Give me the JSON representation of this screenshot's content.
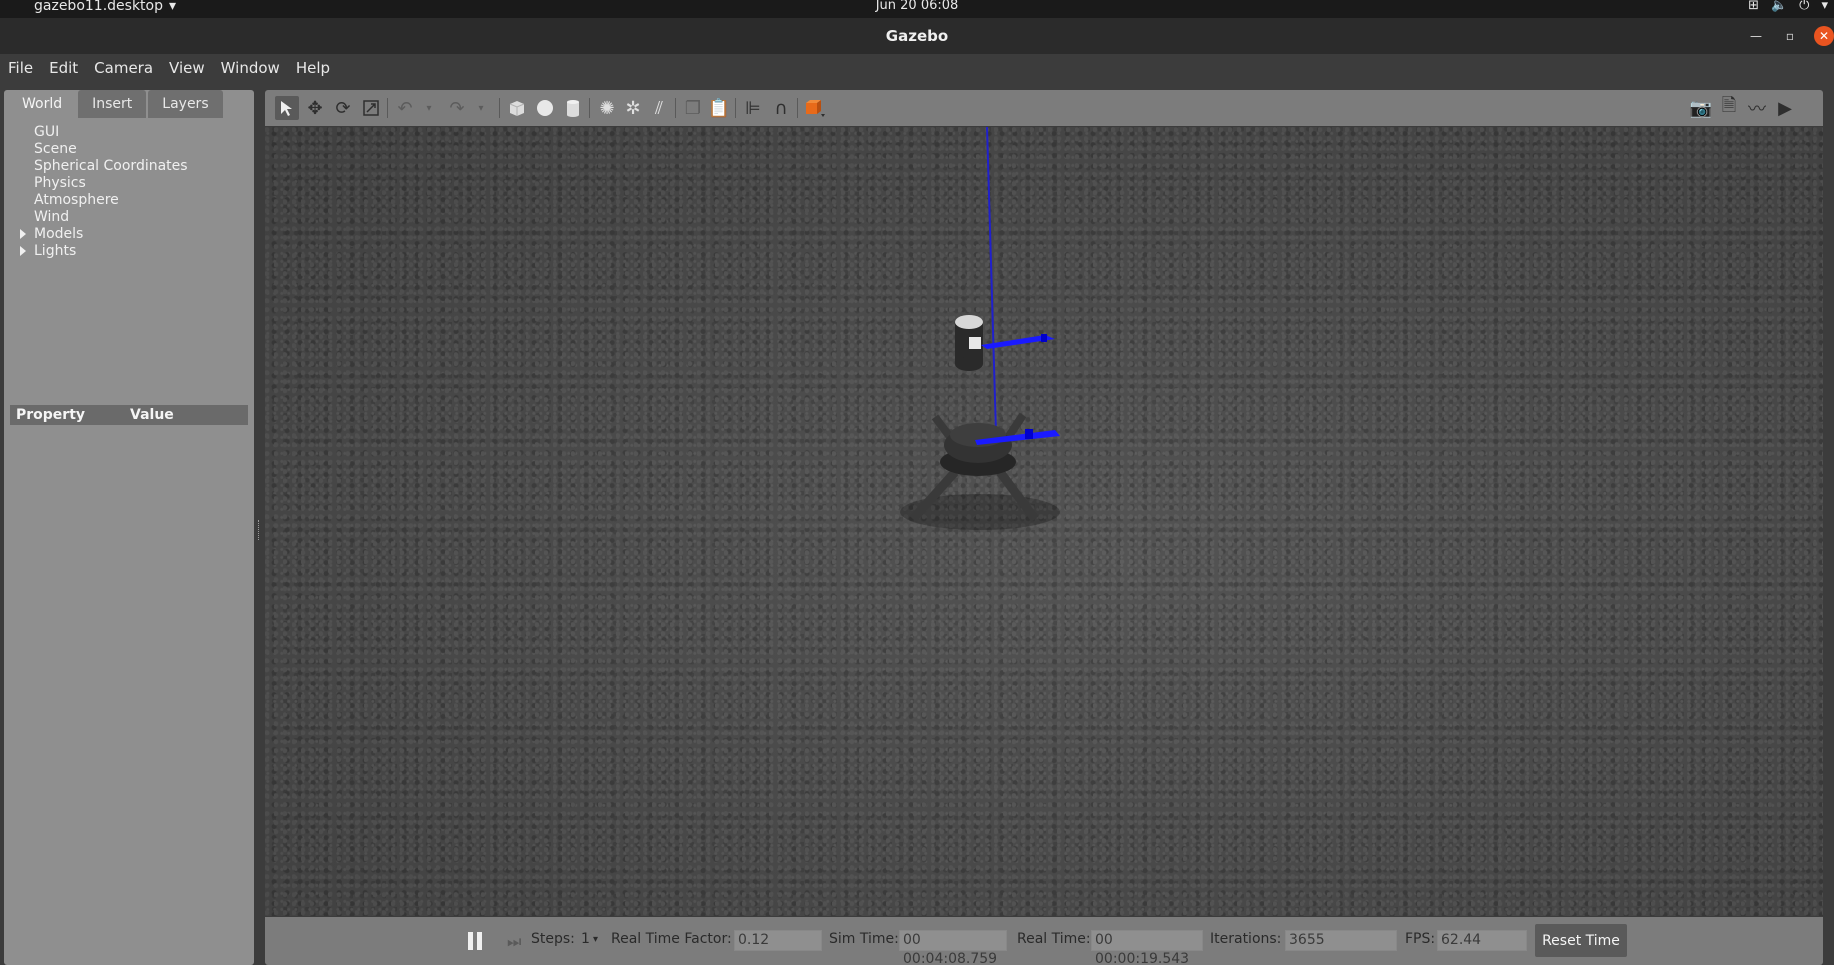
{
  "system_bar": {
    "app_name": "gazebo11.desktop",
    "clock": "Jun 20  06:08"
  },
  "window": {
    "title": "Gazebo"
  },
  "menu": {
    "items": [
      "File",
      "Edit",
      "Camera",
      "View",
      "Window",
      "Help"
    ]
  },
  "left_panel": {
    "tabs": [
      "World",
      "Insert",
      "Layers"
    ],
    "active_tab": "World",
    "tree_items": [
      {
        "label": "GUI",
        "expandable": false
      },
      {
        "label": "Scene",
        "expandable": false
      },
      {
        "label": "Spherical Coordinates",
        "expandable": false
      },
      {
        "label": "Physics",
        "expandable": false
      },
      {
        "label": "Atmosphere",
        "expandable": false
      },
      {
        "label": "Wind",
        "expandable": false
      },
      {
        "label": "Models",
        "expandable": true
      },
      {
        "label": "Lights",
        "expandable": true
      }
    ],
    "property_header": {
      "property": "Property",
      "value": "Value"
    }
  },
  "toolbar": {
    "left_tools": [
      "select-icon",
      "translate-icon",
      "rotate-icon",
      "scale-icon",
      "undo-icon",
      "redo-icon",
      "box-icon",
      "sphere-icon",
      "cylinder-icon",
      "point-light-icon",
      "spot-light-icon",
      "directional-light-icon",
      "copy-icon",
      "paste-icon",
      "align-icon",
      "magnet-icon",
      "view-angle-icon"
    ],
    "right_tools": [
      "screenshot-icon",
      "log-icon",
      "plot-icon",
      "record-video-icon"
    ]
  },
  "bottom_bar": {
    "steps_label": "Steps:",
    "steps_value": "1",
    "real_time_factor_label": "Real Time Factor:",
    "real_time_factor_value": "0.12",
    "sim_time_label": "Sim Time:",
    "sim_time_value": "00 00:04:08.759",
    "real_time_label": "Real Time:",
    "real_time_value": "00 00:00:19.543",
    "iterations_label": "Iterations:",
    "iterations_value": "3655",
    "fps_label": "FPS:",
    "fps_value": "62.44",
    "reset_label": "Reset Time"
  },
  "colors": {
    "accent_close": "#e95420",
    "rotor_blue": "#1a1aff",
    "axis_blue": "#2020cc"
  }
}
